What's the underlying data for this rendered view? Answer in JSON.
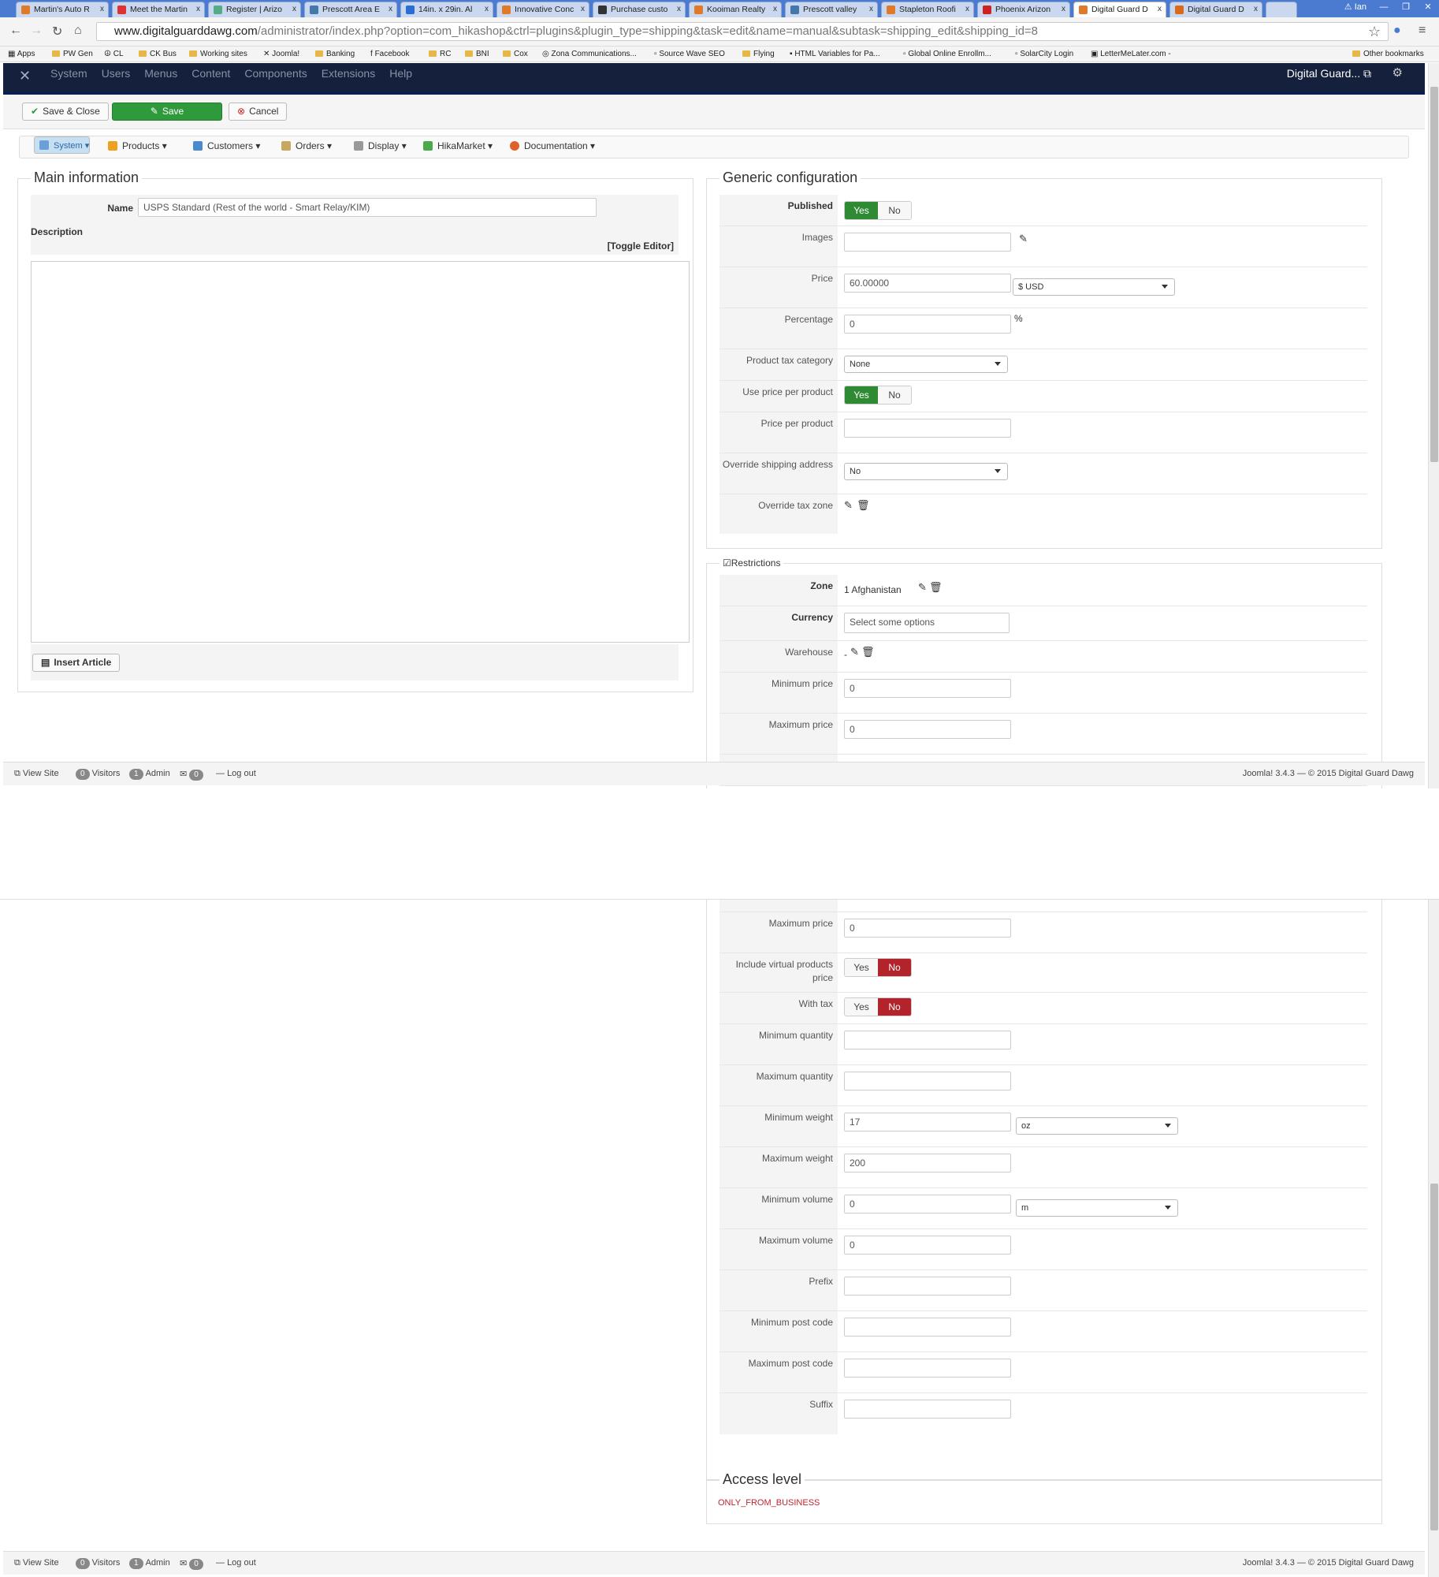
{
  "browser": {
    "tabs": [
      "Martin's Auto R",
      "Meet the Martin",
      "Register | Arizo",
      "Prescott Area E",
      "14in. x 29in. Al",
      "Innovative Conc",
      "Purchase custo",
      "Kooiman Realty",
      "Prescott valley",
      "Stapleton Roofi",
      "Phoenix Arizon",
      "Digital Guard D",
      "Digital Guard D"
    ],
    "tab_close": "x",
    "user": "Ian",
    "url_host": "www.digitalguarddawg.com",
    "url_path": "/administrator/index.php?option=com_hikashop&ctrl=plugins&plugin_type=shipping&task=edit&name=manual&subtask=shipping_edit&shipping_id=8",
    "bookmarks": [
      "Apps",
      "PW Gen",
      "CL",
      "CK Bus",
      "Working sites",
      "Joomla!",
      "Banking",
      "Facebook",
      "RC",
      "BNI",
      "Cox",
      "Zona Communications...",
      "Source Wave SEO",
      "Flying",
      "HTML Variables for Pa...",
      "Global Online Enrollm...",
      "SolarCity Login",
      "LetterMeLater.com -"
    ],
    "other_bookmarks": "Other bookmarks"
  },
  "joomla": {
    "menu": [
      "System",
      "Users",
      "Menus",
      "Content",
      "Components",
      "Extensions",
      "Help"
    ],
    "site_name": "Digital Guard..."
  },
  "toolbar": {
    "save_close": "Save & Close",
    "save": "Save",
    "cancel": "Cancel"
  },
  "hika_menu": [
    "System",
    "Products",
    "Customers",
    "Orders",
    "Display",
    "HikaMarket",
    "Documentation"
  ],
  "main": {
    "legend": "Main information",
    "name_label": "Name",
    "name_value": "USPS Standard (Rest of the world - Smart Relay/KIM)",
    "description_label": "Description",
    "toggle_editor": "[Toggle Editor]",
    "insert_article": "Insert Article"
  },
  "generic": {
    "legend": "Generic configuration",
    "published_label": "Published",
    "yes": "Yes",
    "no": "No",
    "images_label": "Images",
    "price_label": "Price",
    "price_value": "60.00000",
    "currency": "$ USD",
    "percentage_label": "Percentage",
    "percentage_value": "0",
    "percent_sign": "%",
    "tax_category_label": "Product tax category",
    "tax_category_value": "None",
    "use_price_label": "Use price per product",
    "price_per_product_label": "Price per product",
    "override_shipping_label": "Override shipping address",
    "override_shipping_value": "No",
    "override_tax_label": "Override tax zone"
  },
  "restrictions": {
    "legend": "Restrictions",
    "zone_label": "Zone",
    "zone_value": "1 Afghanistan",
    "currency_label": "Currency",
    "currency_placeholder": "Select some options",
    "warehouse_label": "Warehouse",
    "warehouse_value": "-",
    "min_price_label": "Minimum price",
    "min_price_value": "0",
    "max_price_label": "Maximum price",
    "max_price_value": "0",
    "virtual_label": "Include virtual products price",
    "with_tax_label": "With tax",
    "min_qty_label": "Minimum quantity",
    "max_qty_label": "Maximum quantity",
    "min_weight_label": "Minimum weight",
    "min_weight_value": "17",
    "weight_unit": "oz",
    "max_weight_label": "Maximum weight",
    "max_weight_value": "200",
    "min_volume_label": "Minimum volume",
    "min_volume_value": "0",
    "volume_unit": "m",
    "max_volume_label": "Maximum volume",
    "max_volume_value": "0",
    "prefix_label": "Prefix",
    "min_post_label": "Minimum post code",
    "max_post_label": "Maximum post code",
    "suffix_label": "Suffix"
  },
  "access": {
    "legend": "Access level",
    "value": "ONLY_FROM_BUSINESS"
  },
  "footer": {
    "view_site": "View Site",
    "visitors_count": "0",
    "visitors": "Visitors",
    "admin_count": "1",
    "admin": "Admin",
    "msg_count": "0",
    "logout": "Log out",
    "copyright": "Joomla! 3.4.3 — © 2015 Digital Guard Dawg"
  },
  "colors": {
    "header": "#15213c",
    "save_green": "#2f9a3c",
    "yes_green": "#2f8a34",
    "no_red": "#b3232b",
    "access_red": "#c0262d"
  }
}
